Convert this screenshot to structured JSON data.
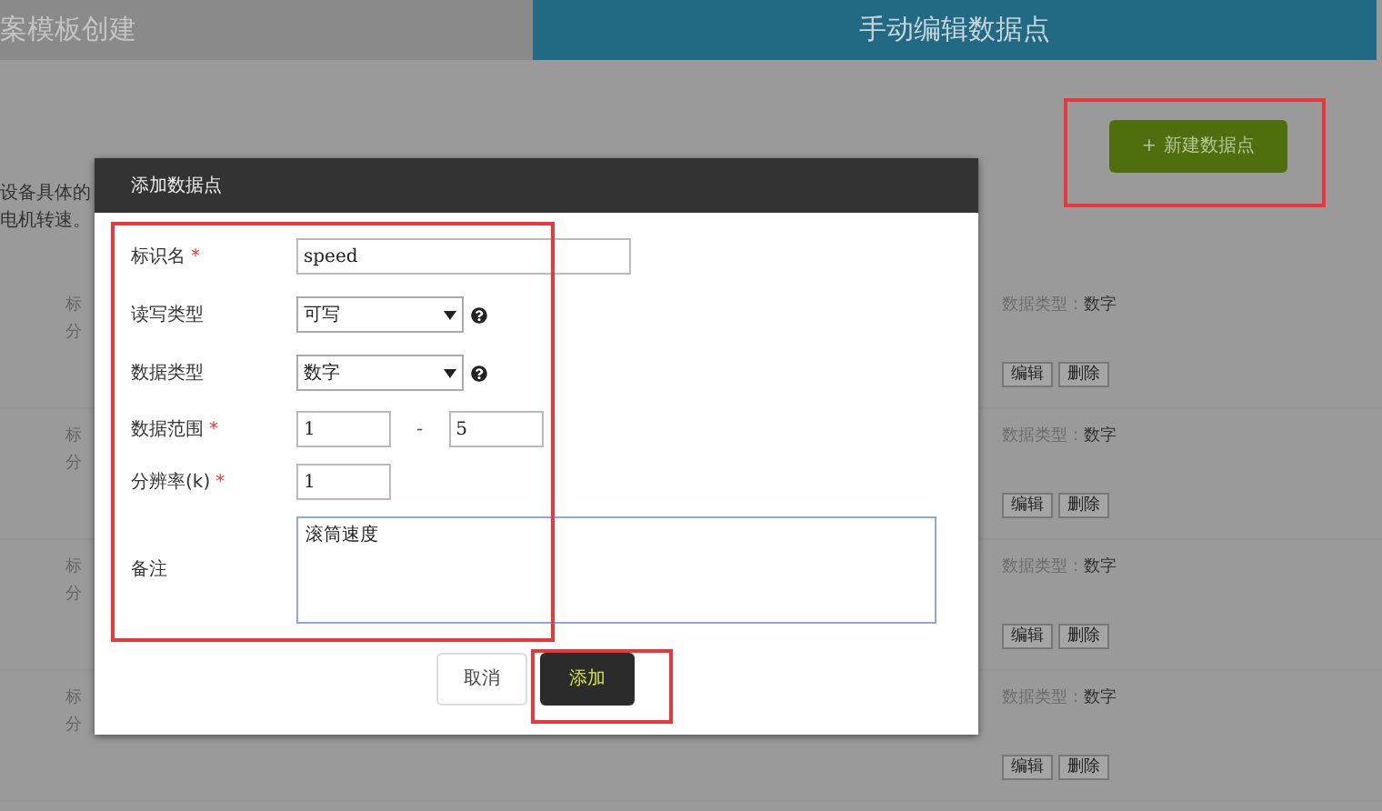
{
  "tabs": [
    {
      "label": "案模板创建",
      "selected": false
    },
    {
      "label": "手动编辑数据点",
      "selected": true
    }
  ],
  "new_button": {
    "icon": "+",
    "label": "新建数据点"
  },
  "intro": [
    "设备具体的",
    "电机转速。"
  ],
  "data_points": [
    {
      "name_cut": "标",
      "resolution_cut": "分",
      "type_label": "数据类型：",
      "type_value": "数字",
      "actions": [
        "编辑",
        "删除"
      ]
    },
    {
      "name_cut": "标",
      "resolution_cut": "分",
      "type_label": "数据类型：",
      "type_value": "数字",
      "actions": [
        "编辑",
        "删除"
      ]
    },
    {
      "name_cut": "标",
      "resolution_cut": "分",
      "type_label": "数据类型：",
      "type_value": "数字",
      "actions": [
        "编辑",
        "删除"
      ]
    },
    {
      "name_cut": "标",
      "resolution_cut": "分",
      "type_label": "数据类型：",
      "type_value": "数字",
      "actions": [
        "编辑",
        "删除"
      ]
    }
  ],
  "dialog": {
    "title": "添加数据点",
    "required_mark": "*",
    "fields": [
      {
        "kind": "text",
        "label": "标识名",
        "required": true,
        "value": "speed"
      },
      {
        "kind": "select",
        "label": "读写类型",
        "required": false,
        "value": "可写",
        "help": true
      },
      {
        "kind": "select",
        "label": "数据类型",
        "required": false,
        "value": "数字",
        "help": true
      },
      {
        "kind": "range",
        "label": "数据范围",
        "required": true,
        "values": [
          "1",
          "5"
        ],
        "separator": "-"
      },
      {
        "kind": "number",
        "label": "分辨率(k)",
        "required": true,
        "value": "1"
      },
      {
        "kind": "textarea",
        "label": "备注",
        "required": false,
        "value": "滚筒速度"
      }
    ],
    "buttons": [
      {
        "kind": "cancel",
        "label": "取消"
      },
      {
        "kind": "primary",
        "label": "添加"
      }
    ]
  }
}
